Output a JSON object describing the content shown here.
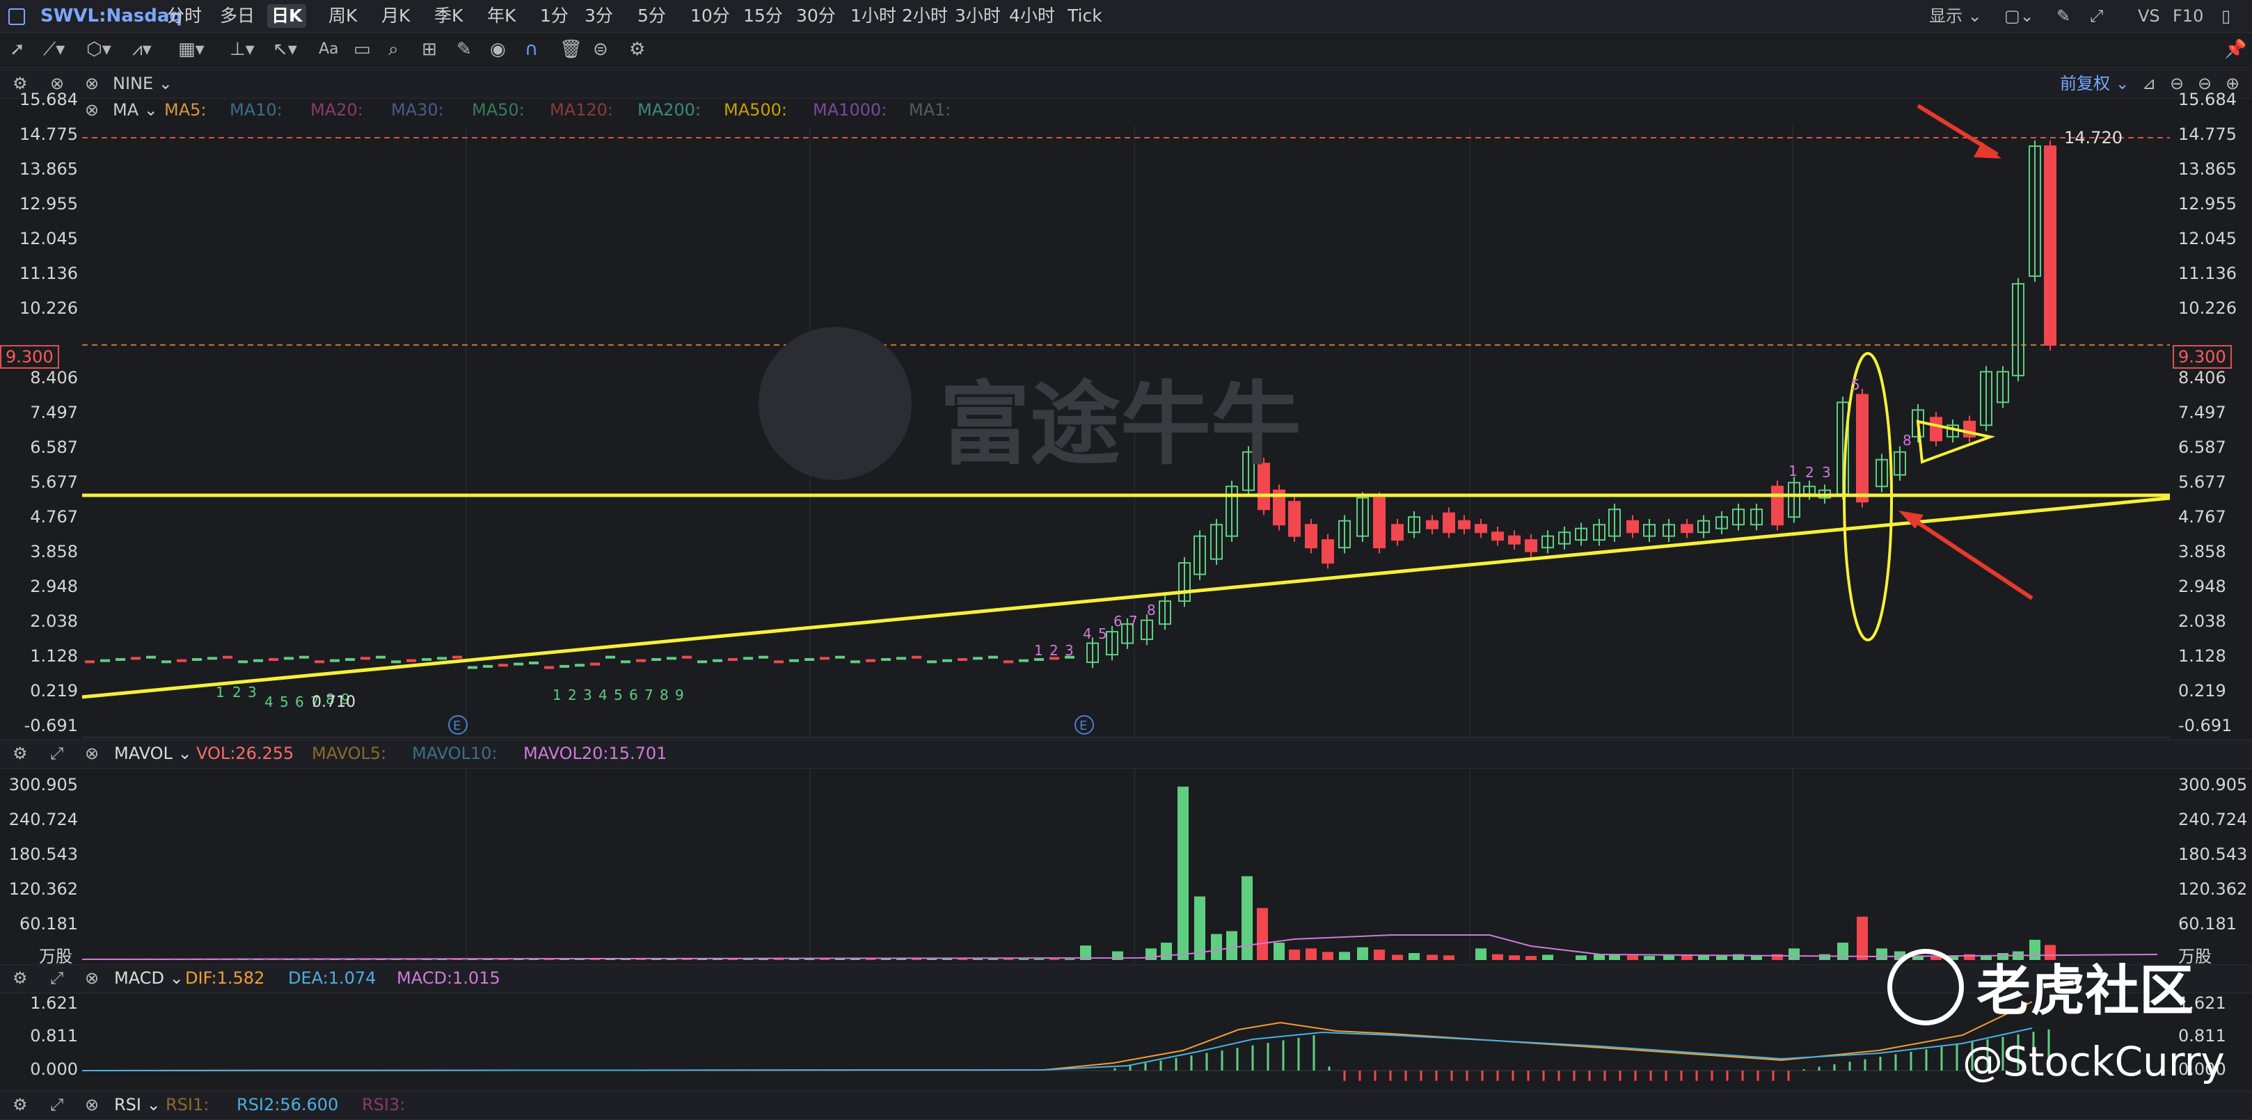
{
  "header": {
    "ticker": "SWVL:Nasdaq",
    "timeframes": [
      "分时",
      "多日",
      "日K",
      "周K",
      "月K",
      "季K",
      "年K",
      "1分",
      "3分",
      "5分",
      "10分",
      "15分",
      "30分",
      "1小时",
      "2小时",
      "3小时",
      "4小时",
      "Tick"
    ],
    "active_timeframe": "日K",
    "display_label": "显示",
    "vs_label": "VS",
    "f10_label": "F10"
  },
  "main_panel": {
    "indicator": "NINE",
    "ma_label": "MA",
    "ma_items": [
      "MA5:",
      "MA10:",
      "MA20:",
      "MA30:",
      "MA50:",
      "MA120:",
      "MA200:",
      "MA500:",
      "MA1000:",
      "MA1:"
    ],
    "ma_colors": [
      "#d29a3a",
      "#3a6f8a",
      "#8a3a6a",
      "#4a5a8a",
      "#3a7a5a",
      "#8a3a3a",
      "#3a8a7a",
      "#c9a000",
      "#7a4a9a",
      "#5a5a5a"
    ],
    "adjust_label": "前复权",
    "y_ticks": [
      "15.684",
      "14.775",
      "13.865",
      "12.955",
      "12.045",
      "11.136",
      "10.226",
      "9.300",
      "8.406",
      "7.497",
      "6.587",
      "5.677",
      "4.767",
      "3.858",
      "2.948",
      "2.038",
      "1.128",
      "0.219",
      "-0.691"
    ],
    "current_price": "9.300",
    "high_label": "14.720",
    "watermark": "富途牛牛",
    "td_labels_1": [
      "1",
      "2",
      "3",
      "4",
      "5",
      "6",
      "7",
      "8",
      "9"
    ],
    "td_labels_2": [
      "1",
      "2",
      "3",
      "4",
      "5",
      "6",
      "7",
      "8",
      "9"
    ],
    "td_labels_3": [
      "1",
      "2",
      "3",
      "4",
      "5",
      "6",
      "7",
      "8"
    ],
    "td_labels_4": [
      "1",
      "2",
      "3",
      "5",
      "8"
    ],
    "low_label": "0.710",
    "event_marker": "E"
  },
  "volume_panel": {
    "label": "MAVOL",
    "vol": "VOL:26.255",
    "mavol5": "MAVOL5:",
    "mavol10": "MAVOL10:",
    "mavol20": "MAVOL20:15.701",
    "y_ticks": [
      "300.905",
      "240.724",
      "180.543",
      "120.362",
      "60.181"
    ],
    "unit": "万股"
  },
  "macd_panel": {
    "label": "MACD",
    "dif": "DIF:1.582",
    "dea": "DEA:1.074",
    "macd": "MACD:1.015",
    "y_ticks": [
      "1.621",
      "0.811",
      "0.000"
    ]
  },
  "rsi_panel": {
    "label": "RSI",
    "rsi1": "RSI1:",
    "rsi2": "RSI2:56.600",
    "rsi3": "RSI3:"
  },
  "overlay": {
    "community": "老虎社区",
    "handle": "@StockCurry"
  },
  "colors": {
    "up": "#5ecf80",
    "down": "#f2474e",
    "annotation_yellow": "#f6f03a",
    "annotation_red": "#e53a2c",
    "price_line": "#d9534f"
  }
}
